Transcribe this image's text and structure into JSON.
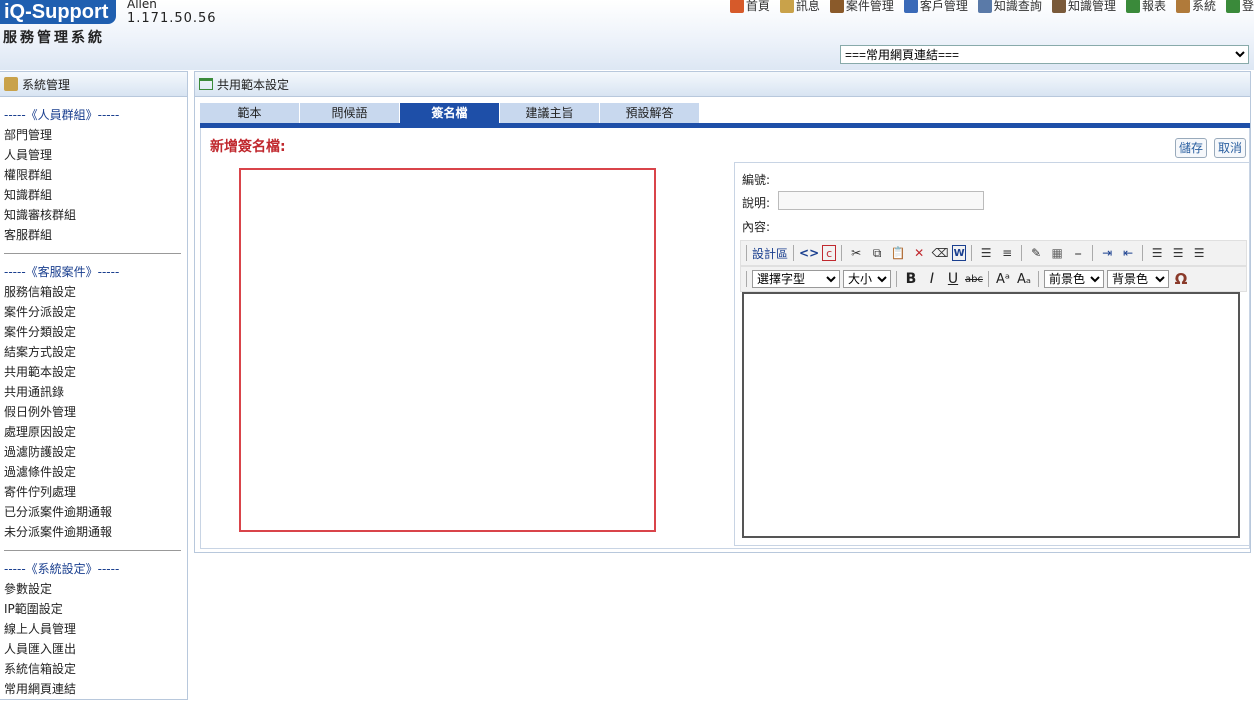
{
  "header": {
    "logo": "iQ-Support",
    "subtitle": "服務管理系統",
    "user": "Allen",
    "ip": "1.171.50.56",
    "nav": [
      {
        "label": "首頁",
        "icon": "home-icon",
        "color": "#d65a2a"
      },
      {
        "label": "訊息",
        "icon": "mail-icon",
        "color": "#c9a24a"
      },
      {
        "label": "案件管理",
        "icon": "folder-icon",
        "color": "#8a5a2a"
      },
      {
        "label": "客戶管理",
        "icon": "user-icon",
        "color": "#3a6ab8"
      },
      {
        "label": "知識查詢",
        "icon": "search-icon",
        "color": "#5a7aa8"
      },
      {
        "label": "知識管理",
        "icon": "book-icon",
        "color": "#7a5a3a"
      },
      {
        "label": "報表",
        "icon": "report-icon",
        "color": "#3a8a3a"
      },
      {
        "label": "系統",
        "icon": "gear-icon",
        "color": "#b07a3a"
      },
      {
        "label": "登",
        "icon": "logout-icon",
        "color": "#3a8a3a"
      }
    ],
    "quick_links": "===常用網頁連結==="
  },
  "sidebar": {
    "title": "系統管理",
    "groups": [
      {
        "title": "-----《人員群組》-----",
        "items": [
          "部門管理",
          "人員管理",
          "權限群組",
          "知識群組",
          "知識審核群組",
          "客服群組"
        ]
      },
      {
        "title": "-----《客服案件》-----",
        "items": [
          "服務信箱設定",
          "案件分派設定",
          "案件分類設定",
          "結案方式設定",
          "共用範本設定",
          "共用通訊錄",
          "假日例外管理",
          "處理原因設定",
          "過濾防護設定",
          "過濾條件設定",
          "寄件佇列處理",
          "已分派案件逾期通報",
          "未分派案件逾期通報"
        ]
      },
      {
        "title": "-----《系統設定》-----",
        "items": [
          "參數設定",
          "IP範圍設定",
          "線上人員管理",
          "人員匯入匯出",
          "系統信箱設定",
          "常用網頁連結"
        ]
      }
    ]
  },
  "main": {
    "title": "共用範本設定",
    "tabs": [
      "範本",
      "問候語",
      "簽名檔",
      "建議主旨",
      "預設解答"
    ],
    "active_tab": "簽名檔",
    "form_title": "新增簽名檔:",
    "save": "儲存",
    "cancel": "取消",
    "fields": {
      "number": "編號:",
      "description": "說明:",
      "content": "內容:"
    },
    "toolbar": {
      "design": "設計區",
      "font_select": "選擇字型",
      "size_select": "大小",
      "fg_select": "前景色",
      "bg_select": "背景色",
      "bold": "B",
      "italic": "I",
      "underline": "U",
      "strike": "abc",
      "superscript": "Aᵃ",
      "subscript": "Aₐ",
      "omega": "Ω"
    }
  }
}
